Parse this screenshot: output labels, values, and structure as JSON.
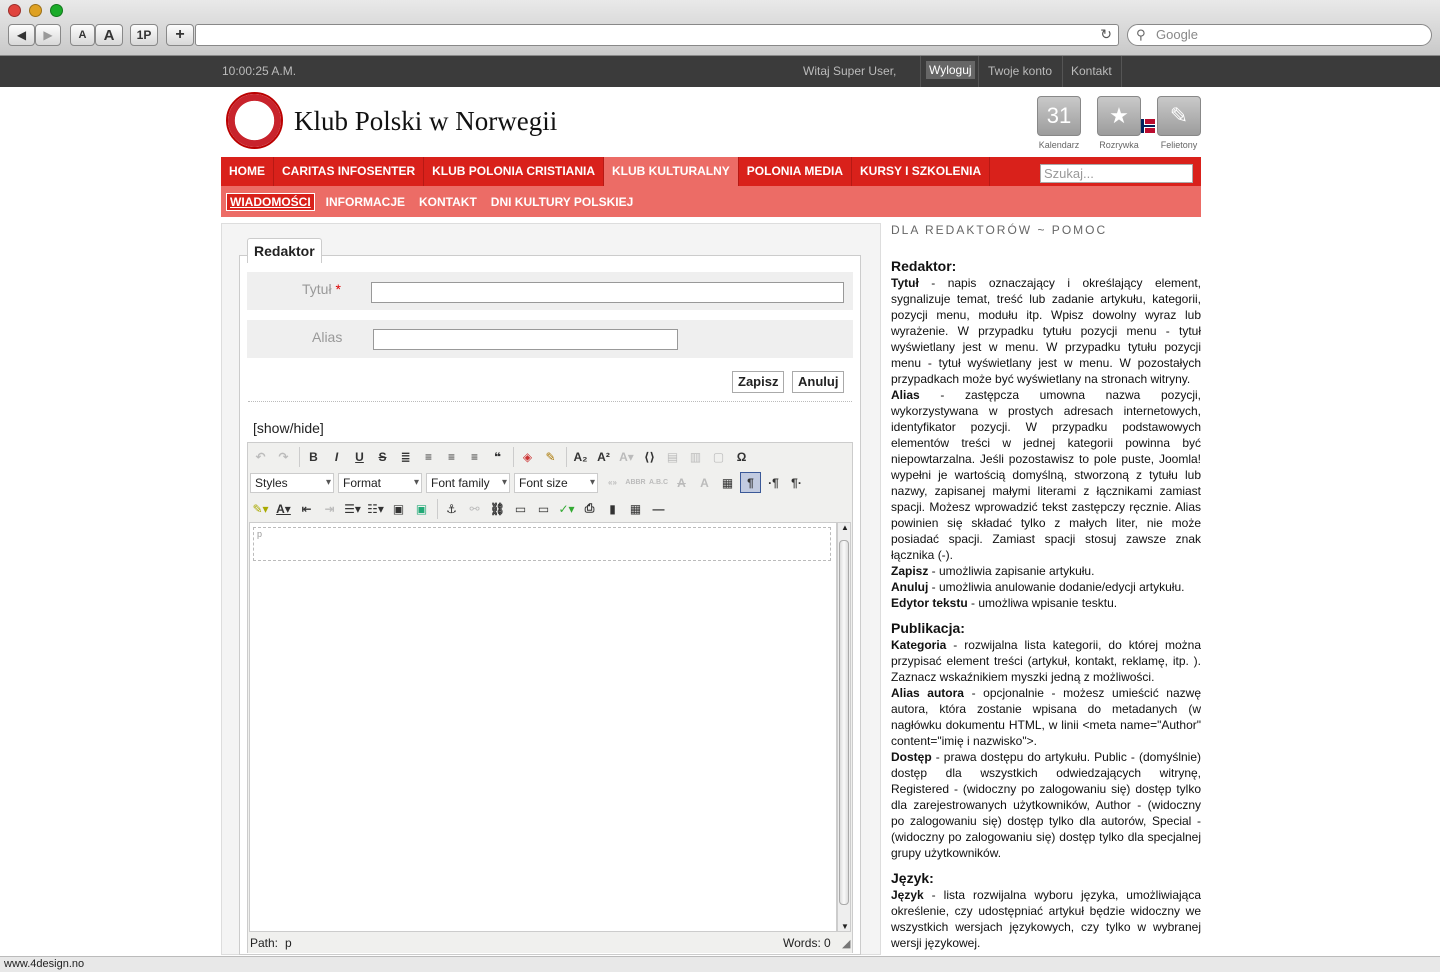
{
  "browser": {
    "nav_back": "◀",
    "nav_forward": "▶",
    "font_small": "A",
    "font_large": "A",
    "onep": "1P",
    "new_tab": "+",
    "search_placeholder": "Google"
  },
  "topbar": {
    "time": "10:00:25 A.M.",
    "welcome": "Witaj Super User,",
    "logout": "Wyloguj",
    "account": "Twoje konto",
    "contact": "Kontakt"
  },
  "header": {
    "site_title": "Klub Polski w Norwegii",
    "icons": [
      {
        "label": "Kalendarz",
        "icon": "calendar-icon",
        "glyph": "31"
      },
      {
        "label": "Rozrywka",
        "icon": "star-icon",
        "glyph": "★"
      },
      {
        "label": "Felietony",
        "icon": "pen-icon",
        "glyph": "✎"
      }
    ]
  },
  "menu": {
    "items": [
      "HOME",
      "CARITAS INFOSENTER",
      "KLUB POLONIA CRISTIANIA",
      "KLUB KULTURALNY",
      "POLONIA MEDIA",
      "KURSY I SZKOLENIA"
    ],
    "active_index": 3,
    "search_placeholder": "Szukaj..."
  },
  "submenu": {
    "items": [
      "WIADOMOŚCI",
      "INFORMACJE",
      "KONTAKT",
      "DNI KULTURY POLSKIEJ"
    ],
    "active_index": 0
  },
  "editor": {
    "legend": "Redaktor",
    "title_label": "Tytuł",
    "required_mark": "*",
    "title_value": "",
    "alias_label": "Alias",
    "alias_value": "",
    "save": "Zapisz",
    "cancel": "Anuluj",
    "showhide": "[show/hide]",
    "dropdowns": {
      "styles": "Styles",
      "format": "Format",
      "font_family": "Font family",
      "font_size": "Font size"
    },
    "paragraph_marker": "p",
    "path_label": "Path:",
    "path_value": "p",
    "words_label": "Words:",
    "words_value": "0"
  },
  "sidebar": {
    "heading": "DLA REDAKTORÓW ~ POMOC",
    "sections": [
      {
        "title": "Redaktor:",
        "paras": [
          {
            "term": "Tytuł",
            "text": " - napis oznaczający i określający element, sygnalizuje temat, treść lub zadanie artykułu, kategorii, pozycji menu, modułu itp. Wpisz dowolny wyraz lub wyrażenie. W przypadku tytułu pozycji menu - tytuł wyświetlany jest w menu. W przypadku tytułu pozycji menu - tytuł wyświetlany jest w menu. W pozostałych przypadkach może być wyświetlany na stronach witryny."
          },
          {
            "term": "Alias",
            "text": " - zastępcza umowna nazwa pozycji, wykorzystywana w prostych adresach internetowych, identyfikator pozycji. W przypadku podstawowych elementów treści w jednej kategorii powinna być niepowtarzalna. Jeśli pozostawisz to pole puste, Joomla! wypełni je wartością domyślną, stworzoną z tytułu lub nazwy, zapisanej małymi literami z łącznikami zamiast spacji. Możesz wprowadzić tekst zastępczy ręcznie. Alias powinien się składać tylko z małych liter, nie może posiadać spacji. Zamiast spacji stosuj zawsze znak łącznika (-)."
          },
          {
            "term": "Zapisz",
            "text": " - umożliwia zapisanie artykułu."
          },
          {
            "term": "Anuluj",
            "text": " - umożliwia anulowanie dodanie/edycji artykułu."
          },
          {
            "term": "Edytor tekstu",
            "text": " - umożliwa wpisanie tesktu."
          }
        ]
      },
      {
        "title": "Publikacja:",
        "paras": [
          {
            "term": "Kategoria",
            "text": " - rozwijalna lista kategorii, do której można przypisać element treści (artykuł, kontakt, reklamę, itp. ). Zaznacz wskaźnikiem myszki jedną z możliwości."
          },
          {
            "term": "Alias autora",
            "text": " - opcjonalnie - możesz umieścić nazwę autora, która zostanie wpisana do metadanych (w nagłówku dokumentu HTML, w linii <meta name=\"Author\" content=\"imię i nazwisko\">."
          },
          {
            "term": "Dostęp",
            "text": " - prawa dostępu do artykułu. Public - (domyślnie) dostęp dla wszystkich odwiedzających witrynę, Registered - (widoczny po zalogowaniu się) dostęp tylko dla zarejestrowanych użytkowników, Author - (widoczny po zalogowaniu się) dostęp tylko dla autorów, Special - (widoczny po zalogowaniu się) dostęp tylko dla specjalnej grupy użytkowników."
          }
        ]
      },
      {
        "title": "Język:",
        "paras": [
          {
            "term": "Język",
            "text": " - lista rozwijalna wyboru języka, umożliwiająca określenie, czy udostępniać artykuł będzie widoczny we wszystkich wersjach językowych, czy tylko w wybranej wersji językowej."
          }
        ]
      }
    ]
  },
  "footer": {
    "status": "www.4design.no"
  },
  "colors": {
    "menu_red": "#d9211b",
    "menu_pink": "#ec6c66",
    "topbar": "#3b3b3b"
  }
}
